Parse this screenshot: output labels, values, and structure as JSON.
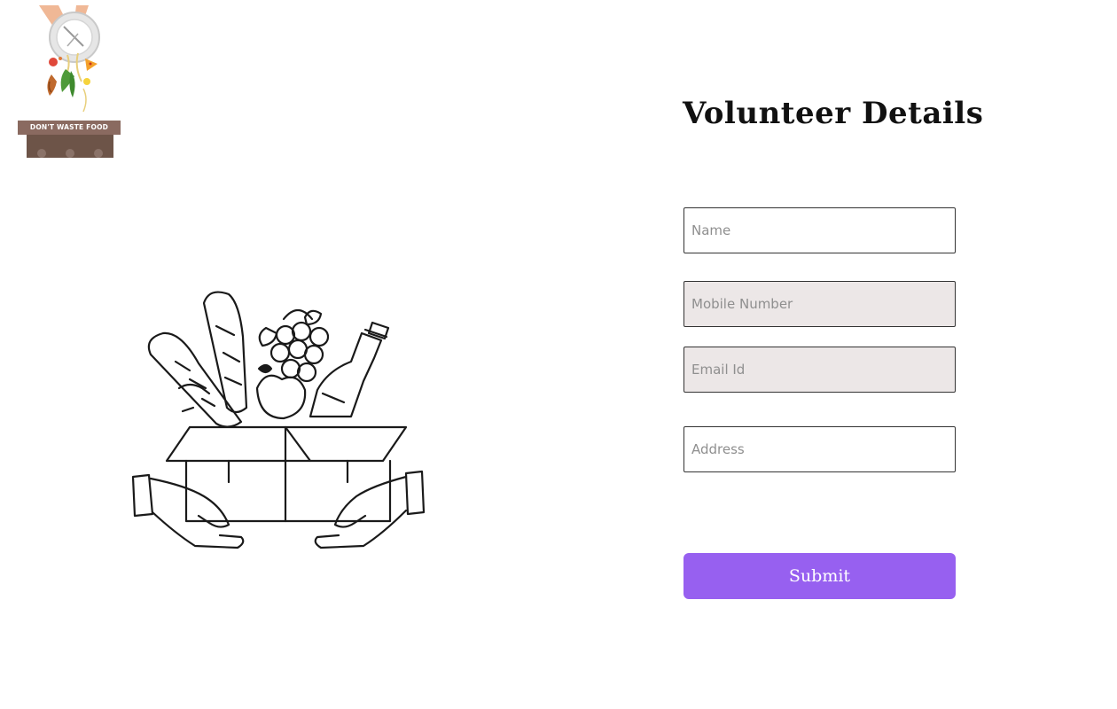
{
  "logo": {
    "banner_text": "DON'T WASTE FOOD"
  },
  "form": {
    "title": "Volunteer Details",
    "fields": {
      "name": {
        "placeholder": "Name"
      },
      "mobile": {
        "placeholder": "Mobile Number"
      },
      "email": {
        "placeholder": "Email Id"
      },
      "address": {
        "placeholder": "Address"
      }
    },
    "submit_label": "Submit"
  },
  "colors": {
    "accent": "#9760f0",
    "field_grey": "#ece7e7",
    "field_border": "#333333"
  },
  "icons": {
    "logo": "dont-waste-food-logo",
    "hero": "food-donation-box-icon"
  }
}
